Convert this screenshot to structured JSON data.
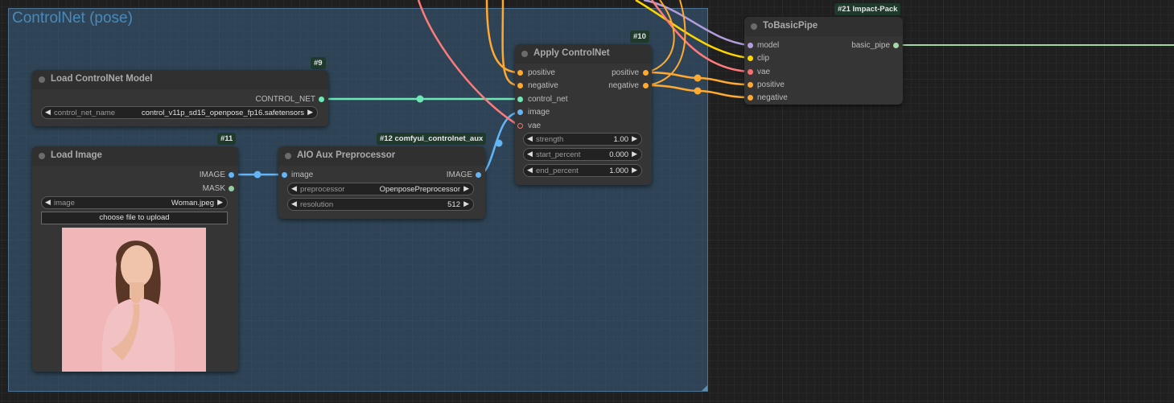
{
  "group": {
    "title": "ControlNet (pose)"
  },
  "nodes": {
    "load_controlnet": {
      "badge": "#9",
      "title": "Load ControlNet Model",
      "output": "CONTROL_NET",
      "widget": {
        "label": "control_net_name",
        "value": "control_v11p_sd15_openpose_fp16.safetensors"
      }
    },
    "load_image": {
      "badge": "#11",
      "title": "Load Image",
      "outputs": [
        "IMAGE",
        "MASK"
      ],
      "widget": {
        "label": "image",
        "value": "Woman.jpeg"
      },
      "upload_label": "choose file to upload"
    },
    "aio": {
      "badge": "#12 comfyui_controlnet_aux",
      "title": "AIO Aux Preprocessor",
      "input": "image",
      "output": "IMAGE",
      "widgets": [
        {
          "label": "preprocessor",
          "value": "OpenposePreprocessor"
        },
        {
          "label": "resolution",
          "value": "512"
        }
      ]
    },
    "apply": {
      "badge": "#10",
      "title": "Apply ControlNet",
      "inputs": [
        "positive",
        "negative",
        "control_net",
        "image",
        "vae"
      ],
      "outputs": [
        "positive",
        "negative"
      ],
      "widgets": [
        {
          "label": "strength",
          "value": "1.00"
        },
        {
          "label": "start_percent",
          "value": "0.000"
        },
        {
          "label": "end_percent",
          "value": "1.000"
        }
      ]
    },
    "tobasic": {
      "badge": "#21 Impact-Pack",
      "title": "ToBasicPipe",
      "inputs": [
        "model",
        "clip",
        "vae",
        "positive",
        "negative"
      ],
      "output": "basic_pipe"
    }
  },
  "colors": {
    "conditioning": "#ffa931",
    "control_net": "#6ee7b7",
    "image": "#64b5f6",
    "vae": "#ff6e6e",
    "model": "#b39ddb",
    "clip": "#ffd500",
    "basic_pipe": "#a5d6a7"
  }
}
